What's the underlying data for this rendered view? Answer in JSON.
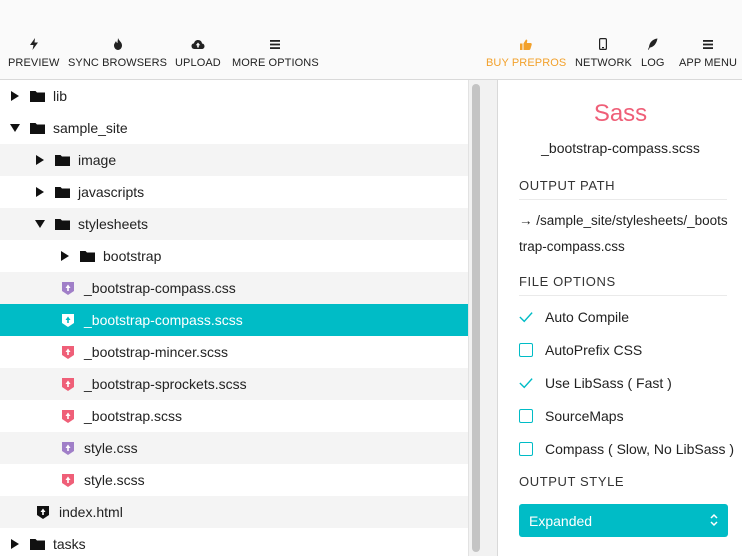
{
  "toolbar": {
    "left": [
      {
        "label": "PREVIEW",
        "icon": "lightning-icon"
      },
      {
        "label": "SYNC BROWSERS",
        "icon": "flame-icon"
      },
      {
        "label": "UPLOAD",
        "icon": "cloud-upload-icon"
      },
      {
        "label": "MORE OPTIONS",
        "icon": "menu-icon"
      }
    ],
    "right": [
      {
        "label": "BUY PREPROS",
        "icon": "thumbs-up-icon"
      },
      {
        "label": "NETWORK",
        "icon": "mobile-icon"
      },
      {
        "label": "LOG",
        "icon": "feather-icon"
      },
      {
        "label": "APP MENU",
        "icon": "menu-icon"
      }
    ]
  },
  "tree": [
    {
      "name": "lib",
      "type": "folder",
      "expanded": false
    },
    {
      "name": "sample_site",
      "type": "folder",
      "expanded": true
    },
    {
      "name": "image",
      "type": "folder",
      "expanded": false
    },
    {
      "name": "javascripts",
      "type": "folder",
      "expanded": false
    },
    {
      "name": "stylesheets",
      "type": "folder",
      "expanded": true
    },
    {
      "name": "bootstrap",
      "type": "folder",
      "expanded": false
    },
    {
      "name": "_bootstrap-compass.css",
      "type": "css"
    },
    {
      "name": "_bootstrap-compass.scss",
      "type": "scss",
      "selected": true
    },
    {
      "name": "_bootstrap-mincer.scss",
      "type": "scss"
    },
    {
      "name": "_bootstrap-sprockets.scss",
      "type": "scss"
    },
    {
      "name": "_bootstrap.scss",
      "type": "scss"
    },
    {
      "name": "style.css",
      "type": "css"
    },
    {
      "name": "style.scss",
      "type": "scss"
    },
    {
      "name": "index.html",
      "type": "html"
    },
    {
      "name": "tasks",
      "type": "folder",
      "expanded": false
    }
  ],
  "panel": {
    "language": "Sass",
    "file_name": "_bootstrap-compass.scss",
    "output_path_heading": "OUTPUT  PATH",
    "output_path": "→ /sample_site/stylesheets/_bootstrap-compass.css",
    "file_options_heading": "FILE  OPTIONS",
    "options": [
      {
        "label": "Auto Compile",
        "checked": true
      },
      {
        "label": "AutoPrefix CSS",
        "checked": false
      },
      {
        "label": "Use LibSass ( Fast )",
        "checked": true
      },
      {
        "label": "SourceMaps",
        "checked": false
      },
      {
        "label": "Compass ( Slow, No LibSass )",
        "checked": false
      }
    ],
    "output_style_heading": "OUTPUT STYLE",
    "output_style": "Expanded"
  },
  "colors": {
    "accent": "#00bcc6",
    "sass": "#ef5f78",
    "css_icon": "#a07fc8",
    "scss_icon": "#ef5f78",
    "buy": "#f2a12c"
  }
}
